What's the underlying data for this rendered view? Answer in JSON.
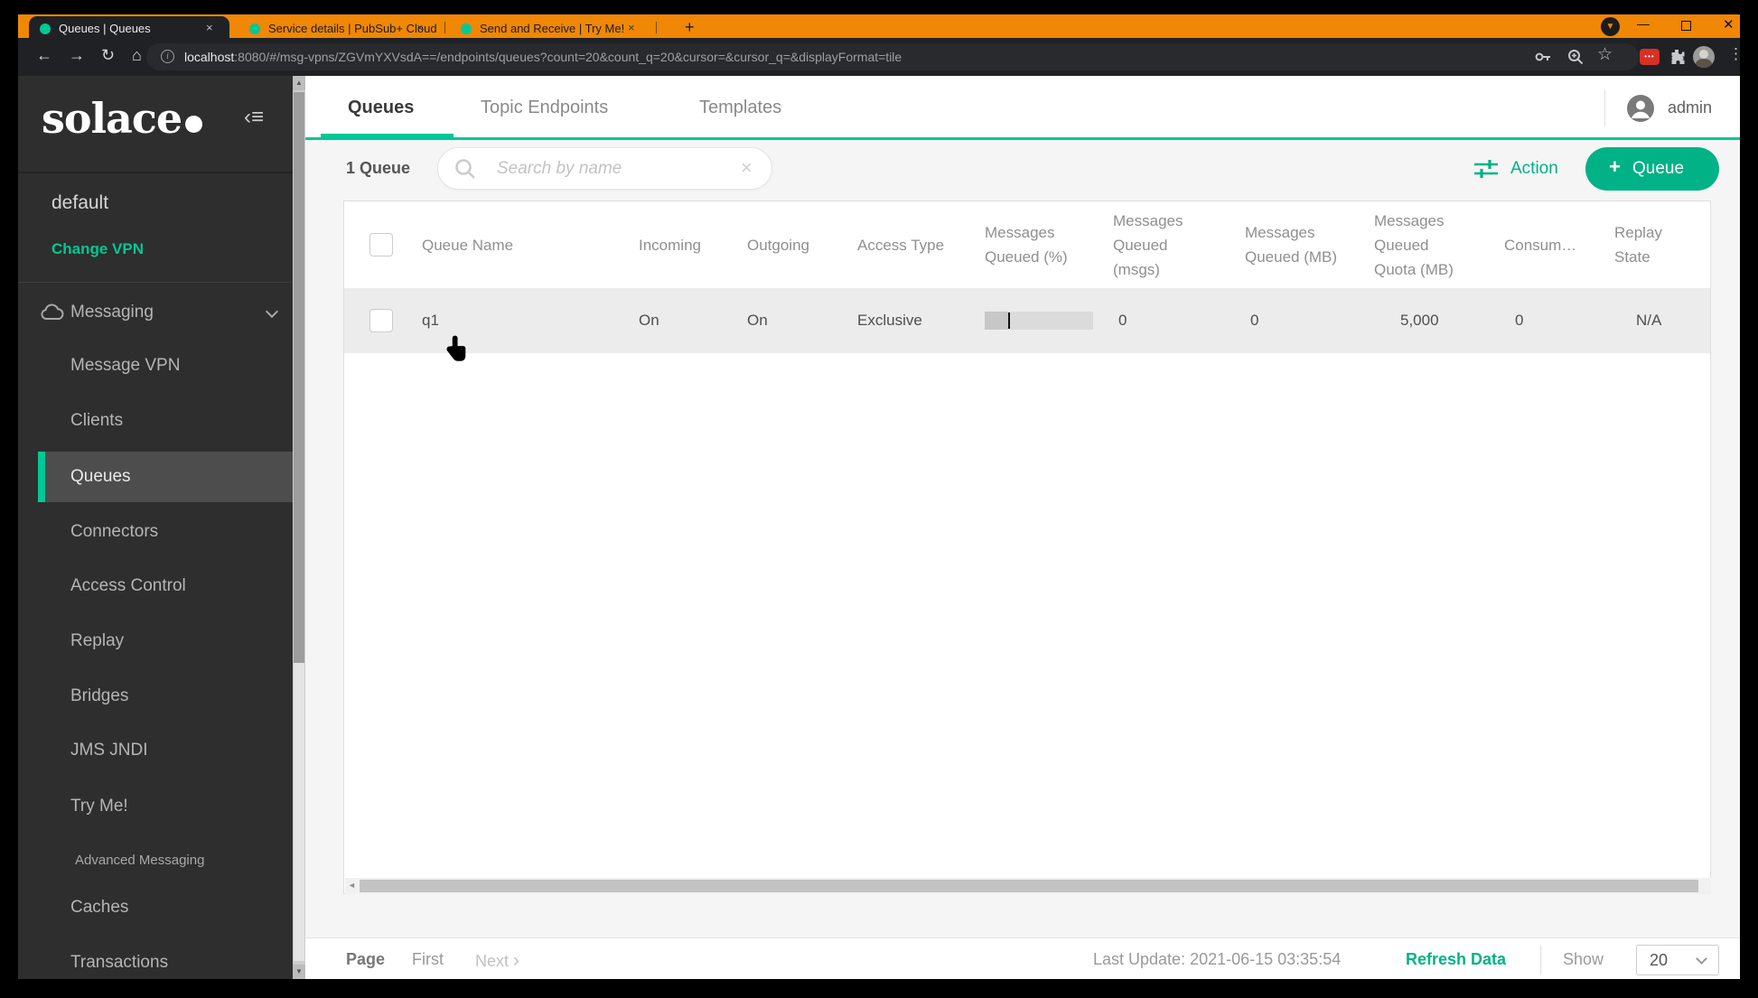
{
  "colors": {
    "accent_green": "#00c895",
    "button_green": "#00b286",
    "frame_orange": "#f08705",
    "sidebar_bg": "#2e2e2e"
  },
  "browser": {
    "tabs": [
      {
        "title": "Queues | Queues",
        "close": "×",
        "active": true
      },
      {
        "title": "Service details | PubSub+ Cloud",
        "close": "×",
        "active": false
      },
      {
        "title": "Send and Receive | Try Me!",
        "close": "×",
        "active": false
      }
    ],
    "new_tab": "+",
    "window_controls": {
      "minimize": "—",
      "close": "✕"
    },
    "nav": {
      "back": "←",
      "forward": "→",
      "reload": "↻",
      "home": "⌂",
      "info": "i"
    },
    "url": {
      "host": "localhost",
      "rest": ":8080/#/msg-vpns/ZGVmYXVsdA==/endpoints/queues?count=20&count_q=20&cursor=&cursor_q=&displayFormat=tile"
    },
    "ext_badge": "•••",
    "menu_dots": "⋮",
    "star": "☆"
  },
  "sidebar": {
    "logo_text": "solace",
    "vpn_name": "default",
    "change_vpn": "Change VPN",
    "section_label": "Messaging",
    "items": [
      {
        "label": "Message VPN"
      },
      {
        "label": "Clients"
      },
      {
        "label": "Queues",
        "active": true
      },
      {
        "label": "Connectors"
      },
      {
        "label": "Access Control"
      },
      {
        "label": "Replay"
      },
      {
        "label": "Bridges"
      },
      {
        "label": "JMS JNDI"
      },
      {
        "label": "Try Me!"
      },
      {
        "label": "Advanced Messaging"
      },
      {
        "label": "Caches"
      },
      {
        "label": "Transactions"
      }
    ],
    "scroll_up": "▲",
    "scroll_down": "▼"
  },
  "header": {
    "tabs": [
      {
        "label": "Queues",
        "active": true
      },
      {
        "label": "Topic Endpoints",
        "active": false
      },
      {
        "label": "Templates",
        "active": false
      }
    ],
    "user": "admin"
  },
  "toolbar": {
    "count_label": "1 Queue",
    "search_placeholder": "Search by name",
    "search_clear": "×",
    "action_label": "Action",
    "add_plus": "+",
    "add_label": "Queue"
  },
  "table": {
    "columns": [
      "Queue Name",
      "Incoming",
      "Outgoing",
      "Access Type",
      "Messages Queued (%)",
      "Messages Queued (msgs)",
      "Messages Queued (MB)",
      "Messages Queued Quota (MB)",
      "Consum…",
      "Replay State"
    ],
    "rows": [
      {
        "name": "q1",
        "incoming": "On",
        "outgoing": "On",
        "access_type": "Exclusive",
        "queued_pct": 0,
        "queued_msgs": "0",
        "queued_mb": "0",
        "quota_mb": "5,000",
        "consumers": "0",
        "replay_state": "N/A"
      }
    ],
    "hscroll_left_arrow": "◄"
  },
  "footer": {
    "page_label": "Page",
    "first_label": "First",
    "next_label": "Next",
    "next_chevron": "›",
    "last_update": "Last Update: 2021-06-15 03:35:54",
    "refresh_label": "Refresh Data",
    "show_label": "Show",
    "page_size": "20"
  }
}
